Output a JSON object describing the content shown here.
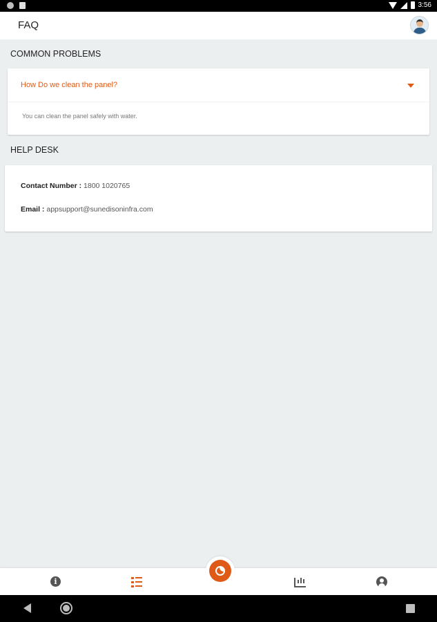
{
  "status_bar": {
    "time": "3:56"
  },
  "app_bar": {
    "title": "FAQ"
  },
  "sections": {
    "common_problems": "COMMON PROBLEMS",
    "help_desk": "HELP DESK"
  },
  "faq": [
    {
      "question": "How Do we clean the panel?",
      "answer": "You can clean the panel safely with water.",
      "expanded": true
    }
  ],
  "help_desk": {
    "contact_label": "Contact Number :",
    "contact_value": "1800 1020765",
    "email_label": "Email :",
    "email_value": "appsupport@sunedisoninfra.com"
  },
  "bottom_nav": {
    "items": [
      {
        "icon": "info-icon",
        "active": false
      },
      {
        "icon": "checklist-icon",
        "active": true
      },
      {
        "icon": "gauge-icon",
        "active": false,
        "center": true
      },
      {
        "icon": "bar-chart-icon",
        "active": false
      },
      {
        "icon": "account-circle-icon",
        "active": false
      }
    ]
  },
  "colors": {
    "accent": "#e05a17",
    "background": "#eceff0",
    "card": "#ffffff",
    "icon_inactive": "#555555"
  }
}
